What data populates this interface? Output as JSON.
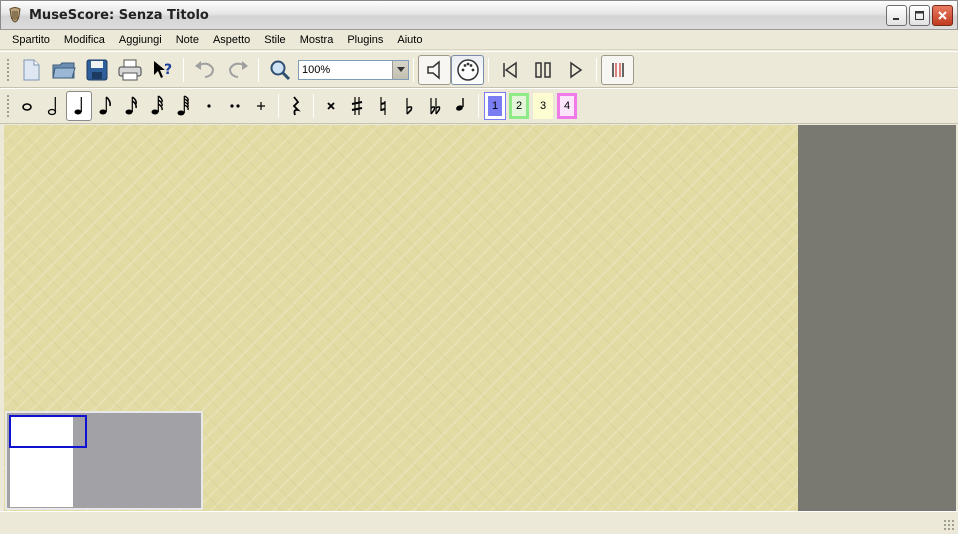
{
  "window": {
    "title": "MuseScore: Senza Titolo"
  },
  "menu": [
    "Spartito",
    "Modifica",
    "Aggiungi",
    "Note",
    "Aspetto",
    "Stile",
    "Mostra",
    "Plugins",
    "Aiuto"
  ],
  "toolbar": {
    "zoom_value": "100%"
  },
  "note_toolbar": {
    "voices": [
      "1",
      "2",
      "3",
      "4"
    ],
    "colors": {
      "voice1": "#7a7cf2",
      "voice2": "#8fea88",
      "voice3": "#fdfdd1",
      "voice4": "#f07be8"
    }
  },
  "canvas": {
    "paper_color": "#e2dca4",
    "side_color": "#797971"
  }
}
